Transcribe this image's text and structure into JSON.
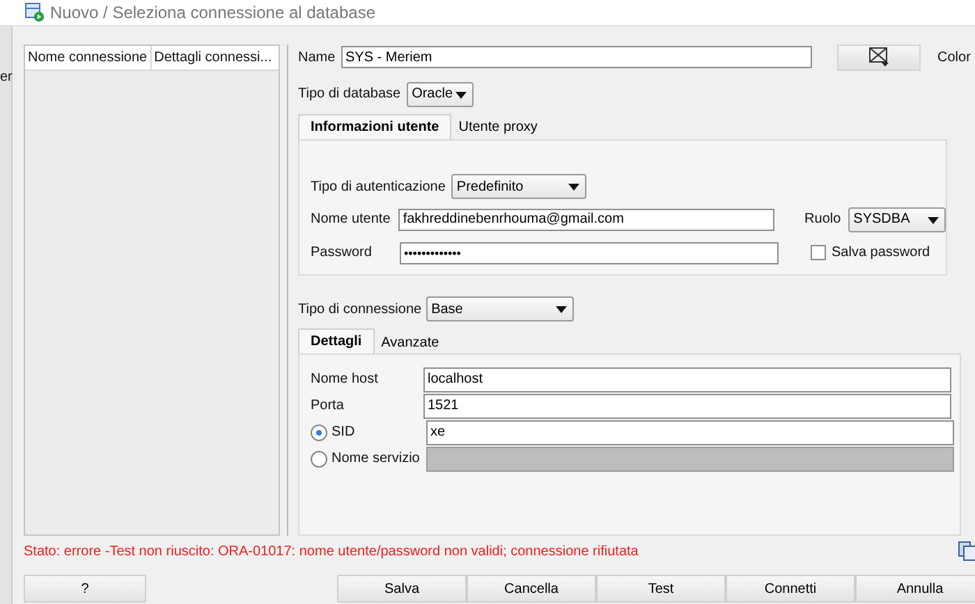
{
  "background_window": {
    "text": "er"
  },
  "window": {
    "title": "Nuovo / Seleziona connessione al database"
  },
  "connections_table": {
    "columns": [
      "Nome connessione",
      "Dettagli connessi..."
    ]
  },
  "name": {
    "label": "Name",
    "value": "SYS - Meriem"
  },
  "color": {
    "label": "Color"
  },
  "database_type": {
    "label": "Tipo di database",
    "value": "Oracle"
  },
  "user_tabs": [
    {
      "label": "Informazioni utente",
      "selected": true
    },
    {
      "label": "Utente proxy",
      "selected": false
    }
  ],
  "auth_type": {
    "label": "Tipo di autenticazione",
    "value": "Predefinito"
  },
  "username": {
    "label": "Nome utente",
    "value": "fakhreddinebenrhouma@gmail.com"
  },
  "role": {
    "label": "Ruolo",
    "value": "SYSDBA"
  },
  "password": {
    "label": "Password",
    "value": "•••••••••••••"
  },
  "save_password": {
    "label": "Salva password",
    "checked": false
  },
  "connection_type": {
    "label": "Tipo di connessione",
    "value": "Base"
  },
  "detail_tabs": [
    {
      "label": "Dettagli",
      "selected": true
    },
    {
      "label": "Avanzate",
      "selected": false
    }
  ],
  "fields": [
    {
      "kind": "text",
      "label": "Nome host",
      "value": "localhost"
    },
    {
      "kind": "text",
      "label": "Porta",
      "value": "1521"
    },
    {
      "kind": "radio",
      "label": "SID",
      "selected": true,
      "value": "xe",
      "disabled": false
    },
    {
      "kind": "radio",
      "label": "Nome servizio",
      "selected": false,
      "disabled": true
    }
  ],
  "status": "Stato: errore -Test non riuscito: ORA-01017: nome utente/password non validi; connessione rifiutata",
  "buttons": [
    {
      "label": "?"
    },
    {
      "label": "Salva"
    },
    {
      "label": "Cancella"
    },
    {
      "label": "Test"
    },
    {
      "label": "Connetti"
    },
    {
      "label": "Annulla"
    }
  ]
}
